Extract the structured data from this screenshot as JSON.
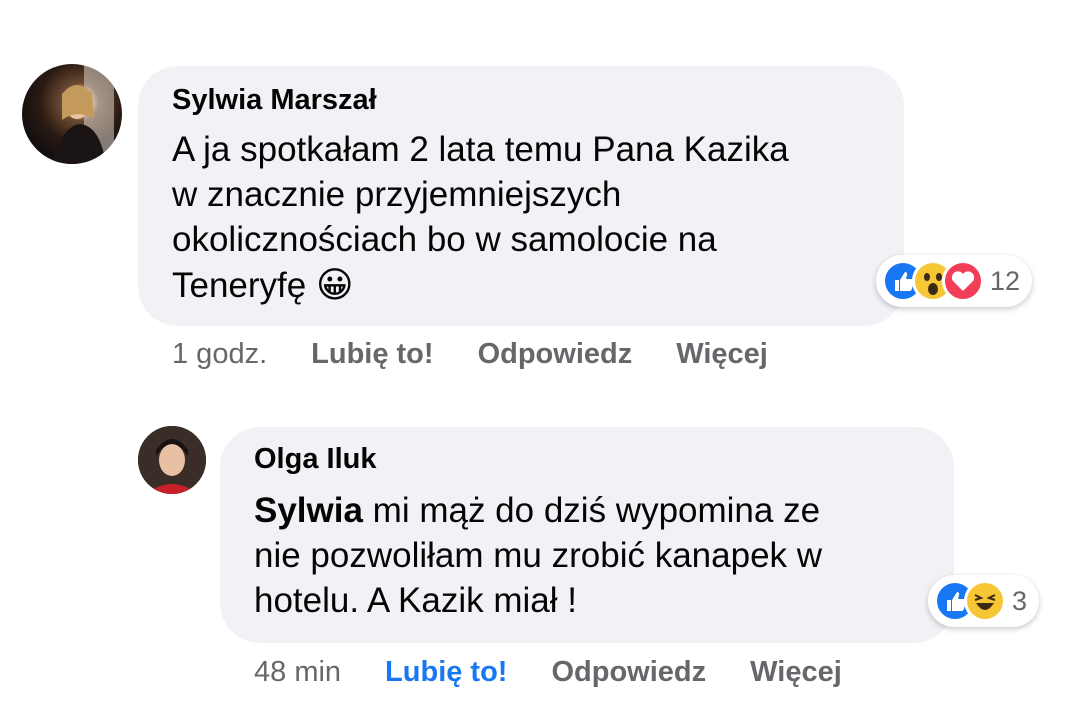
{
  "comments": [
    {
      "author": "Sylwia Marszał",
      "text_lines": [
        "A ja spotkałam 2 lata temu Pana Kazika",
        "w znacznie przyjemniejszych",
        "okolicznościach bo w samolocie na",
        "Teneryfę"
      ],
      "emoji": "😀",
      "reaction_icons": [
        "like-icon",
        "wow-icon",
        "love-icon"
      ],
      "reaction_count": "12",
      "time": "1 godz.",
      "like_label": "Lubię to!",
      "reply_label": "Odpowiedz",
      "more_label": "Więcej"
    },
    {
      "author": "Olga Iluk",
      "mention": "Sylwia",
      "text_lines": [
        " mi mąż do dziś wypomina ze",
        "nie pozwoliłam mu zrobić kanapek w",
        "hotelu. A Kazik miał !"
      ],
      "reaction_icons": [
        "like-icon",
        "haha-icon"
      ],
      "reaction_count": "3",
      "time": "48 min",
      "like_label": "Lubię to!",
      "like_active": true,
      "reply_label": "Odpowiedz",
      "more_label": "Więcej"
    }
  ],
  "colors": {
    "bubble": "#f0f2f5",
    "like_active": "#1877f2",
    "meta": "#65676b"
  }
}
